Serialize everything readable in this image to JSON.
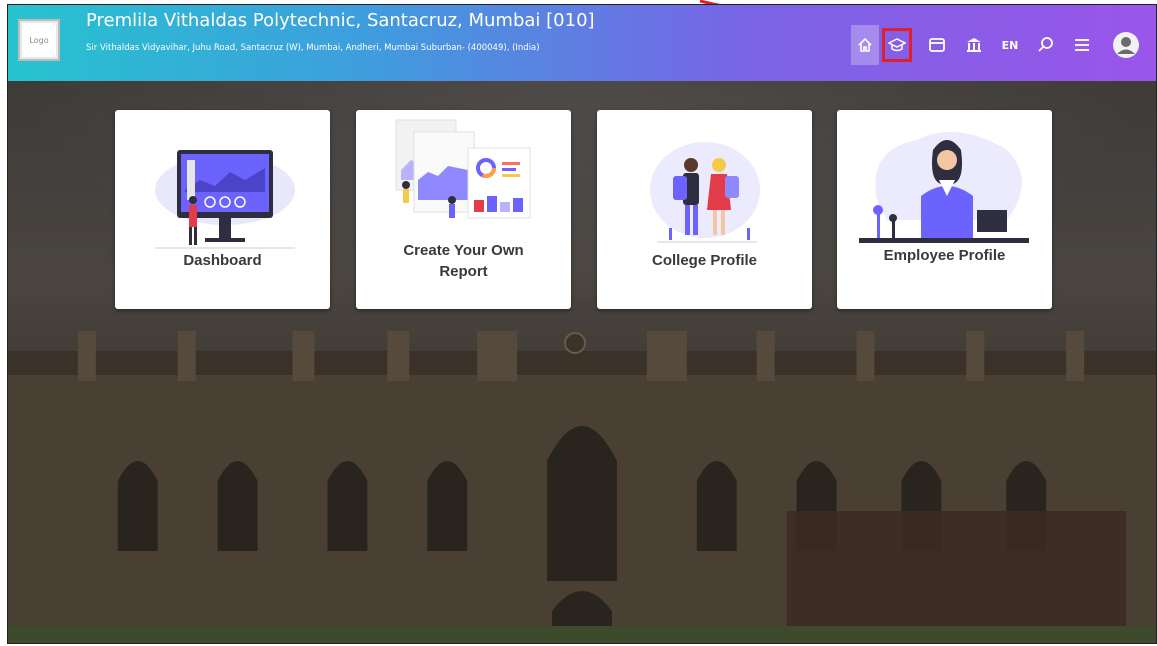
{
  "header": {
    "logo_text": "Logo",
    "title": "Premlila Vithaldas Polytechnic, Santacruz, Mumbai [010]",
    "address": "Sir Vithaldas Vidyavihar, Juhu Road, Santacruz (W), Mumbai, Andheri, Mumbai Suburban- (400049), (India)",
    "language": "EN",
    "icons": [
      "home-icon",
      "graduation-cap-icon",
      "window-icon",
      "institution-icon",
      "language-toggle",
      "search-icon",
      "menu-icon",
      "user-avatar"
    ]
  },
  "tiles": [
    {
      "label": "Dashboard"
    },
    {
      "label_line1": "Create Your Own",
      "label_line2": "Report"
    },
    {
      "label": "College Profile"
    },
    {
      "label": "Employee Profile"
    }
  ],
  "colors": {
    "header_gradient_start": "#27c3cf",
    "header_gradient_end": "#9a55ea",
    "annotation_red": "#e0202a",
    "accent_purple": "#6c63ff"
  }
}
